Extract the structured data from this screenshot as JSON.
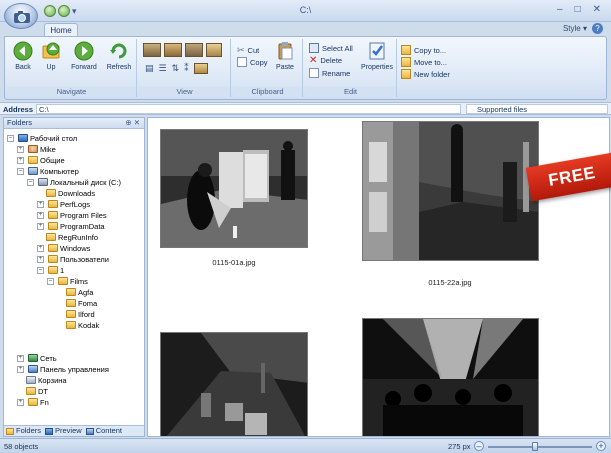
{
  "window": {
    "title": "C:\\",
    "minimize": "–",
    "maximize": "□",
    "close": "✕"
  },
  "ribbon": {
    "tab_home": "Home",
    "style_label": "Style",
    "navigate": {
      "label": "Navigate",
      "back": "Back",
      "up": "Up",
      "forward": "Forward",
      "refresh": "Refresh"
    },
    "view": {
      "label": "View"
    },
    "clipboard": {
      "label": "Clipboard",
      "cut": "Cut",
      "copy": "Copy",
      "paste": "Paste"
    },
    "edit": {
      "label": "Edit",
      "select_all": "Select All",
      "delete": "Delete",
      "rename": "Rename",
      "properties": "Properties"
    },
    "organize": {
      "copy_to": "Copy to...",
      "move_to": "Move to...",
      "new_folder": "New folder"
    }
  },
  "address": {
    "label": "Address",
    "value": "C:\\",
    "filter": "Supported files"
  },
  "folders_panel": {
    "title": "Folders",
    "pin": "⊕ ✕",
    "tree": [
      "Рабочий стол",
      "Mike",
      "Общие",
      "Компьютер",
      "Локальный диск (C:)",
      "Downloads",
      "PerfLogs",
      "Program Files",
      "ProgramData",
      "RegRunInfo",
      "Windows",
      "Пользователи",
      "1",
      "Films",
      "Agfa",
      "Foma",
      "Ilford",
      "Kodak",
      "Сеть",
      "Панель управления",
      "Корзина",
      "DT",
      "Fn"
    ],
    "tabs": {
      "folders": "Folders",
      "preview": "Preview",
      "content": "Content"
    }
  },
  "files": [
    {
      "name": "0115-01a.jpg"
    },
    {
      "name": "0115-22a.jpg"
    }
  ],
  "badge": "FREE",
  "status": {
    "count": "58 objects",
    "zoom": "275 px"
  },
  "zoom_fraction": 0.45
}
